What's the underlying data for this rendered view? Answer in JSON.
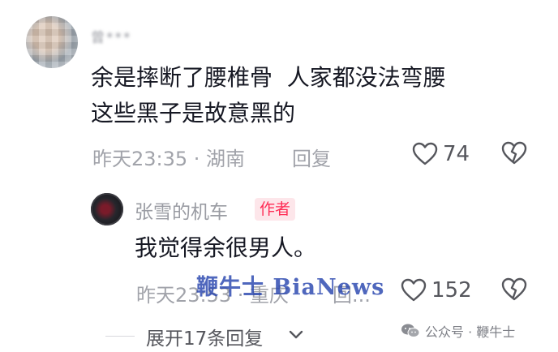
{
  "comment": {
    "username": "曾***",
    "text_line1": "余是摔断了腰椎骨  人家都没法弯腰",
    "text_line2": "这些黑子是故意黑的",
    "meta": "昨天23:35 · 湖南",
    "reply_label": "回复",
    "like_count": "74"
  },
  "reply": {
    "username": "张雪的机车",
    "author_tag": "作者",
    "text": "我觉得余很男人。",
    "meta": "昨天23:53 · 重庆",
    "reply_label": "回...",
    "like_count": "152"
  },
  "expand": {
    "label": "展开17条回复"
  },
  "watermarks": {
    "bianews": "鞭牛士 BiaNews",
    "wechat": "公众号 · 鞭牛士"
  },
  "colors": {
    "text": "#161823",
    "secondary": "#a1a3aa",
    "author_tag_bg": "#fde6ea",
    "author_tag_text": "#fe2c55",
    "watermark": "#2846af"
  }
}
